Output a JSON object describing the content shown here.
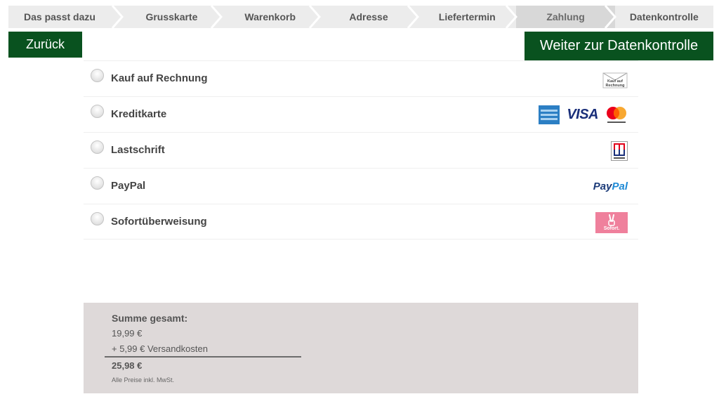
{
  "stepper": {
    "steps": [
      {
        "label": "Das passt dazu"
      },
      {
        "label": "Grusskarte"
      },
      {
        "label": "Warenkorb"
      },
      {
        "label": "Adresse"
      },
      {
        "label": "Liefertermin"
      },
      {
        "label": "Zahlung",
        "active": true
      },
      {
        "label": "Datenkontrolle"
      }
    ]
  },
  "buttons": {
    "back_label": "Zurück",
    "next_label": "Weiter zur Datenkontrolle"
  },
  "payments": [
    {
      "label": "Kauf auf Rechnung",
      "logos": [
        "invoice-logo"
      ],
      "invoice_text": "Kauf auf Rechnung"
    },
    {
      "label": "Kreditkarte",
      "logos": [
        "amex-logo",
        "visa-logo",
        "mastercard-logo"
      ],
      "visa_text": "VISA"
    },
    {
      "label": "Lastschrift",
      "logos": [
        "ec-logo"
      ]
    },
    {
      "label": "PayPal",
      "logos": [
        "paypal-logo"
      ],
      "paypal_text_1": "Pay",
      "paypal_text_2": "Pal"
    },
    {
      "label": "Sofortüberweisung",
      "logos": [
        "sofort-logo"
      ],
      "sofort_text": "Sofort."
    }
  ],
  "summary": {
    "title": "Summe gesamt:",
    "price": "19,99 €",
    "shipping": "+ 5,99 € Versandkosten",
    "total": "25,98 €",
    "note": "Alle Preise inkl. MwSt."
  },
  "colors": {
    "primary_green": "#09521f",
    "step_bg": "#ececec",
    "step_active_bg": "#d8d8d8",
    "summary_bg": "#ded9d9"
  }
}
